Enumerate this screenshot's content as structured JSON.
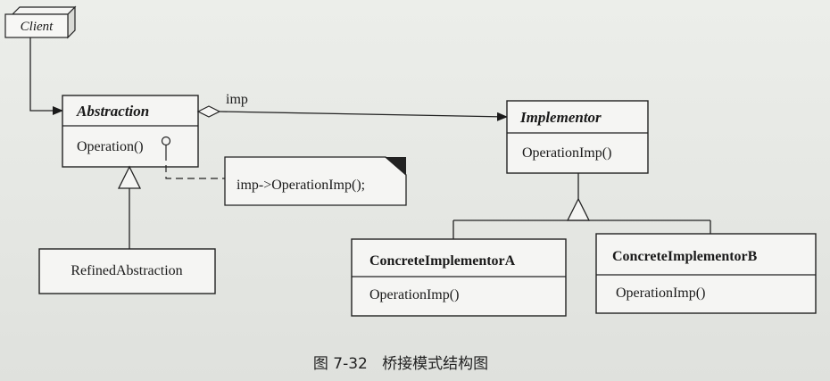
{
  "client": {
    "label": "Client"
  },
  "abstraction": {
    "title": "Abstraction",
    "operation": "Operation()"
  },
  "association": {
    "label": "imp"
  },
  "note": {
    "text": "imp->OperationImp();"
  },
  "implementor": {
    "title": "Implementor",
    "operation": "OperationImp()"
  },
  "refined_abstraction": {
    "title": "RefinedAbstraction"
  },
  "concrete_a": {
    "title": "ConcreteImplementorA",
    "operation": "OperationImp()"
  },
  "concrete_b": {
    "title": "ConcreteImplementorB",
    "operation": "OperationImp()"
  },
  "caption": {
    "text": "图 7-32   桥接模式结构图"
  }
}
